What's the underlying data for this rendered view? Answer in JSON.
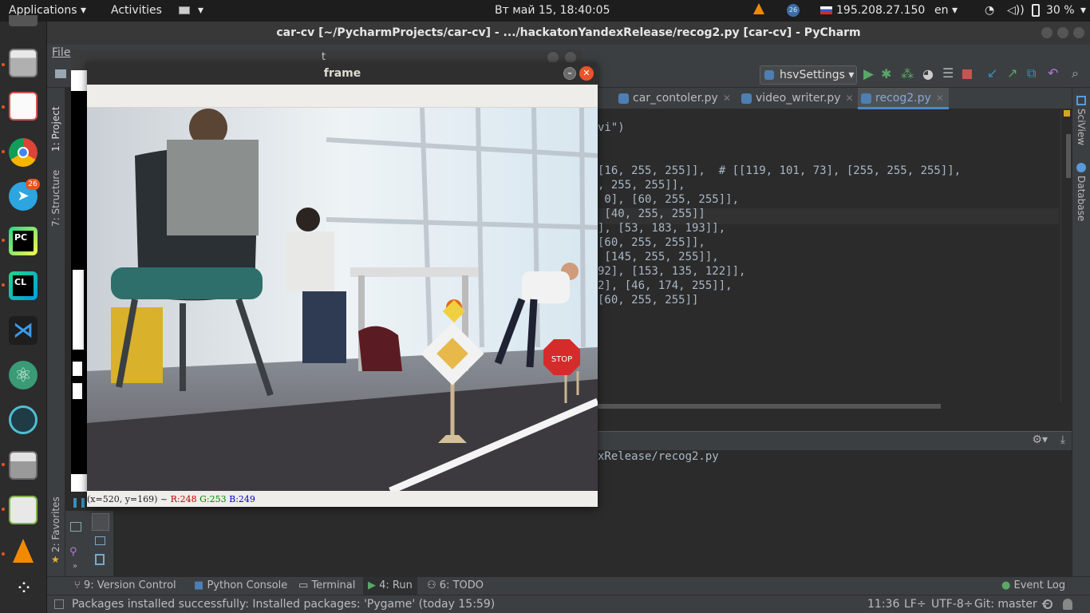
{
  "topbar": {
    "applications": "Applications",
    "activities": "Activities",
    "clock": "Вт май 15, 18:40:05",
    "notif_badge": "26",
    "ip": "195.208.27.150",
    "lang": "en",
    "battery": "30 %"
  },
  "launcher": {
    "items": [
      "files-icon",
      "text-editor-icon",
      "chrome-icon",
      "telegram-icon",
      "pycharm-icon",
      "clion-icon",
      "vscode-icon",
      "atom-icon",
      "gitkraken-icon",
      "calculator-icon",
      "image-viewer-icon",
      "vlc-icon",
      "show-apps-icon"
    ],
    "telegram_badge": "26",
    "pycharm_label": "PC",
    "clion_label": "CL"
  },
  "pycharm": {
    "window_title": "car-cv [~/PycharmProjects/car-cv] - .../hackatonYandexRelease/recog2.py [car-cv] - PyCharm",
    "menu_file": "File",
    "run_config": "hsvSettings",
    "tabs": [
      {
        "label": "car_contoler.py",
        "active": false
      },
      {
        "label": "video_writer.py",
        "active": false
      },
      {
        "label": "recog2.py",
        "active": true
      }
    ],
    "left_tools": {
      "project": "1: Project",
      "structure": "7: Structure",
      "favorites": "2: Favorites"
    },
    "right_tools": {
      "sciview": "SciView",
      "database": "Database"
    },
    "code_lines": [
      "vi\")",
      "",
      "",
      "[16, 255, 255]],  # [[119, 101, 73], [255, 255, 255]],",
      ", 255, 255]],",
      " 0], [60, 255, 255]],",
      " [40, 255, 255]]",
      "], [53, 183, 193]],",
      "[60, 255, 255]],",
      " [145, 255, 255]],",
      "92], [153, 135, 122]],",
      "2], [46, 174, 255]],",
      "[60, 255, 255]]"
    ],
    "run_output": "xRelease/recog2.py",
    "bottom_tabs": {
      "version_control": "9: Version Control",
      "python_console": "Python Console",
      "terminal": "Terminal",
      "run": "4: Run",
      "todo": "6: TODO",
      "event_log": "Event Log"
    },
    "status": {
      "message": "Packages installed successfully: Installed packages: 'Pygame' (today 15:59)",
      "position": "11:36",
      "line_sep": "LF÷",
      "encoding": "UTF-8÷",
      "git": "Git: master ÷"
    }
  },
  "back_window": {
    "title_fragment": "t"
  },
  "frame": {
    "title": "frame",
    "status_coords": "(x=520, y=169) ~",
    "r": "R:248",
    "g": "G:253",
    "b": "B:249",
    "sign_text": "STOP"
  },
  "colors": {
    "accent_ubuntu": "#e95420",
    "pycharm_bg": "#2b2b2b",
    "panel": "#3c3f41",
    "active_tab_line": "#4a88c7"
  }
}
